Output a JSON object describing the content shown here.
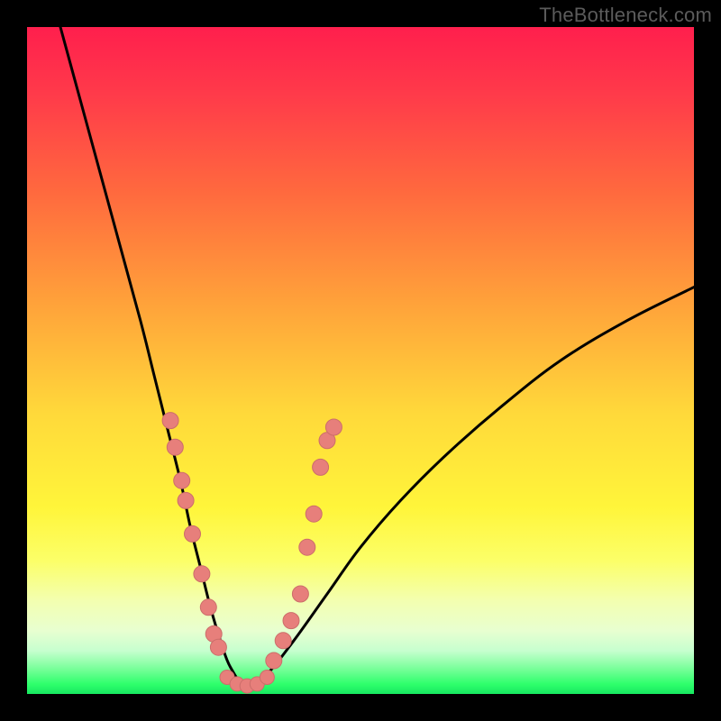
{
  "watermark": "TheBottleneck.com",
  "colors": {
    "bg_black": "#000000",
    "curve": "#000000",
    "dot_fill": "#e77f7b",
    "dot_stroke": "#cc6e6a",
    "gradient_stops": [
      {
        "offset": 0.0,
        "color": "#ff1f4d"
      },
      {
        "offset": 0.1,
        "color": "#ff3a4a"
      },
      {
        "offset": 0.25,
        "color": "#ff6a3e"
      },
      {
        "offset": 0.42,
        "color": "#ffa43a"
      },
      {
        "offset": 0.58,
        "color": "#ffd93a"
      },
      {
        "offset": 0.72,
        "color": "#fff53a"
      },
      {
        "offset": 0.8,
        "color": "#fcff68"
      },
      {
        "offset": 0.86,
        "color": "#f3ffb0"
      },
      {
        "offset": 0.905,
        "color": "#e8ffd0"
      },
      {
        "offset": 0.935,
        "color": "#c7ffcf"
      },
      {
        "offset": 0.96,
        "color": "#7fff9e"
      },
      {
        "offset": 0.985,
        "color": "#2fff6c"
      },
      {
        "offset": 1.0,
        "color": "#17e860"
      }
    ]
  },
  "chart_data": {
    "type": "line",
    "title": "",
    "xlabel": "",
    "ylabel": "",
    "xlim": [
      0,
      100
    ],
    "ylim": [
      0,
      100
    ],
    "grid": false,
    "legend": false,
    "series": [
      {
        "name": "bottleneck-curve",
        "x": [
          5,
          8,
          11,
          14,
          17,
          19,
          21,
          23,
          24.5,
          26,
          27.5,
          29,
          30.5,
          33,
          36,
          40,
          45,
          50,
          56,
          63,
          71,
          80,
          90,
          100
        ],
        "y": [
          100,
          89,
          78,
          67,
          56,
          48,
          40,
          32,
          25,
          19,
          13,
          8,
          4,
          1,
          3,
          8,
          15,
          22,
          29,
          36,
          43,
          50,
          56,
          61
        ]
      }
    ],
    "points_left": [
      {
        "x": 21.5,
        "y": 41
      },
      {
        "x": 22.2,
        "y": 37
      },
      {
        "x": 23.2,
        "y": 32
      },
      {
        "x": 23.8,
        "y": 29
      },
      {
        "x": 24.8,
        "y": 24
      },
      {
        "x": 26.2,
        "y": 18
      },
      {
        "x": 27.2,
        "y": 13
      },
      {
        "x": 28.0,
        "y": 9
      },
      {
        "x": 28.7,
        "y": 7
      }
    ],
    "points_right": [
      {
        "x": 37.0,
        "y": 5
      },
      {
        "x": 38.4,
        "y": 8
      },
      {
        "x": 39.6,
        "y": 11
      },
      {
        "x": 41.0,
        "y": 15
      },
      {
        "x": 42.0,
        "y": 22
      },
      {
        "x": 43.0,
        "y": 27
      },
      {
        "x": 44.0,
        "y": 34
      },
      {
        "x": 45.0,
        "y": 38
      },
      {
        "x": 46.0,
        "y": 40
      }
    ],
    "points_bottom": [
      {
        "x": 30.0,
        "y": 2.5
      },
      {
        "x": 31.5,
        "y": 1.5
      },
      {
        "x": 33.0,
        "y": 1.2
      },
      {
        "x": 34.5,
        "y": 1.5
      },
      {
        "x": 36.0,
        "y": 2.5
      }
    ]
  }
}
